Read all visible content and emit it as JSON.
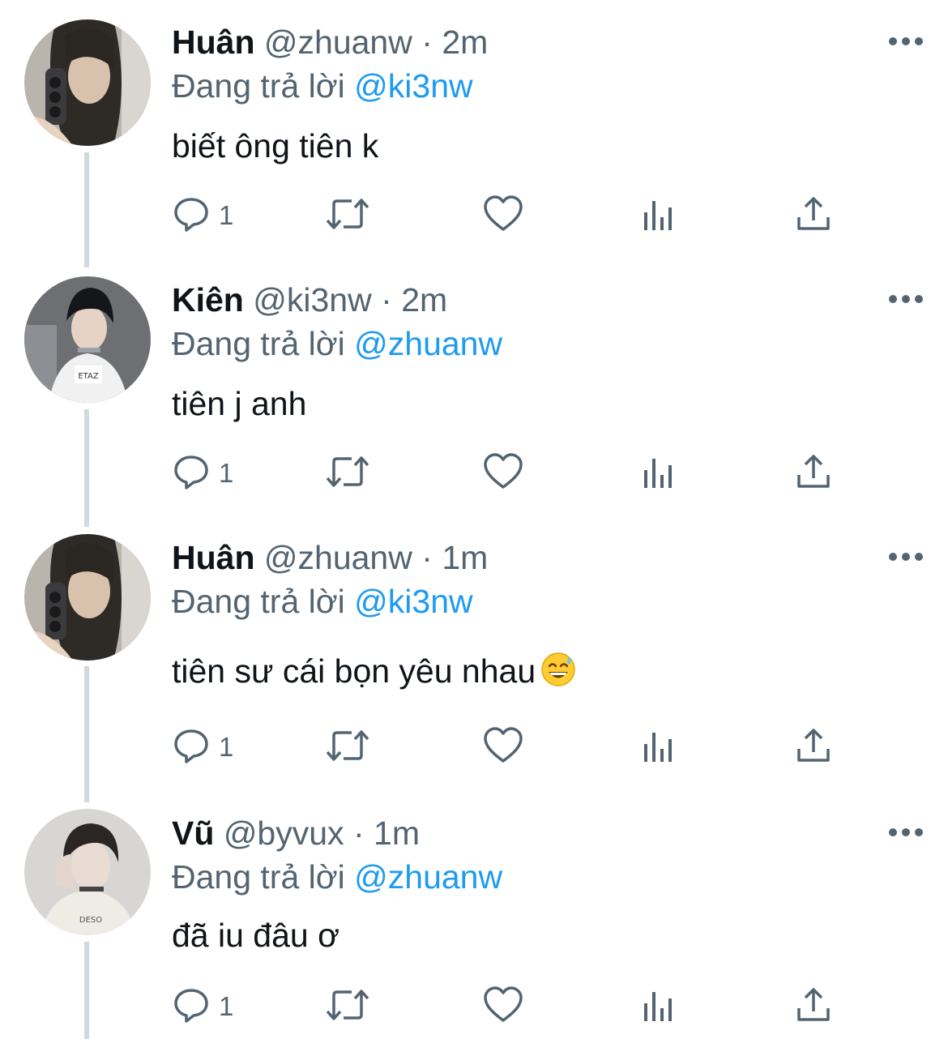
{
  "reply_prefix": "Đang trả lời",
  "dot": "·",
  "colors": {
    "text": "#0f1419",
    "secondary": "#536471",
    "accent": "#1d9bf0",
    "thread_line": "#cfd9de"
  },
  "tweets": [
    {
      "name": "Huân",
      "handle": "@zhuanw",
      "time": "2m",
      "reply_to": "@ki3nw",
      "text": "biết ông tiên k",
      "emoji": "",
      "reply_count": "1",
      "avatar": "avatar-huan"
    },
    {
      "name": "Kiên",
      "handle": "@ki3nw",
      "time": "2m",
      "reply_to": "@zhuanw",
      "text": "tiên j anh",
      "emoji": "",
      "reply_count": "1",
      "avatar": "avatar-kien"
    },
    {
      "name": "Huân",
      "handle": "@zhuanw",
      "time": "1m",
      "reply_to": "@ki3nw",
      "text": "tiên sư cái bọn yêu nhau",
      "emoji": "grinning-face-with-sweat-emoji",
      "reply_count": "1",
      "avatar": "avatar-huan"
    },
    {
      "name": "Vũ",
      "handle": "@byvux",
      "time": "1m",
      "reply_to": "@zhuanw",
      "text": "đã iu đâu ơ",
      "emoji": "",
      "reply_count": "1",
      "avatar": "avatar-vu"
    }
  ],
  "action_icons": [
    "reply-icon",
    "retweet-icon",
    "like-icon",
    "views-icon",
    "share-icon"
  ]
}
